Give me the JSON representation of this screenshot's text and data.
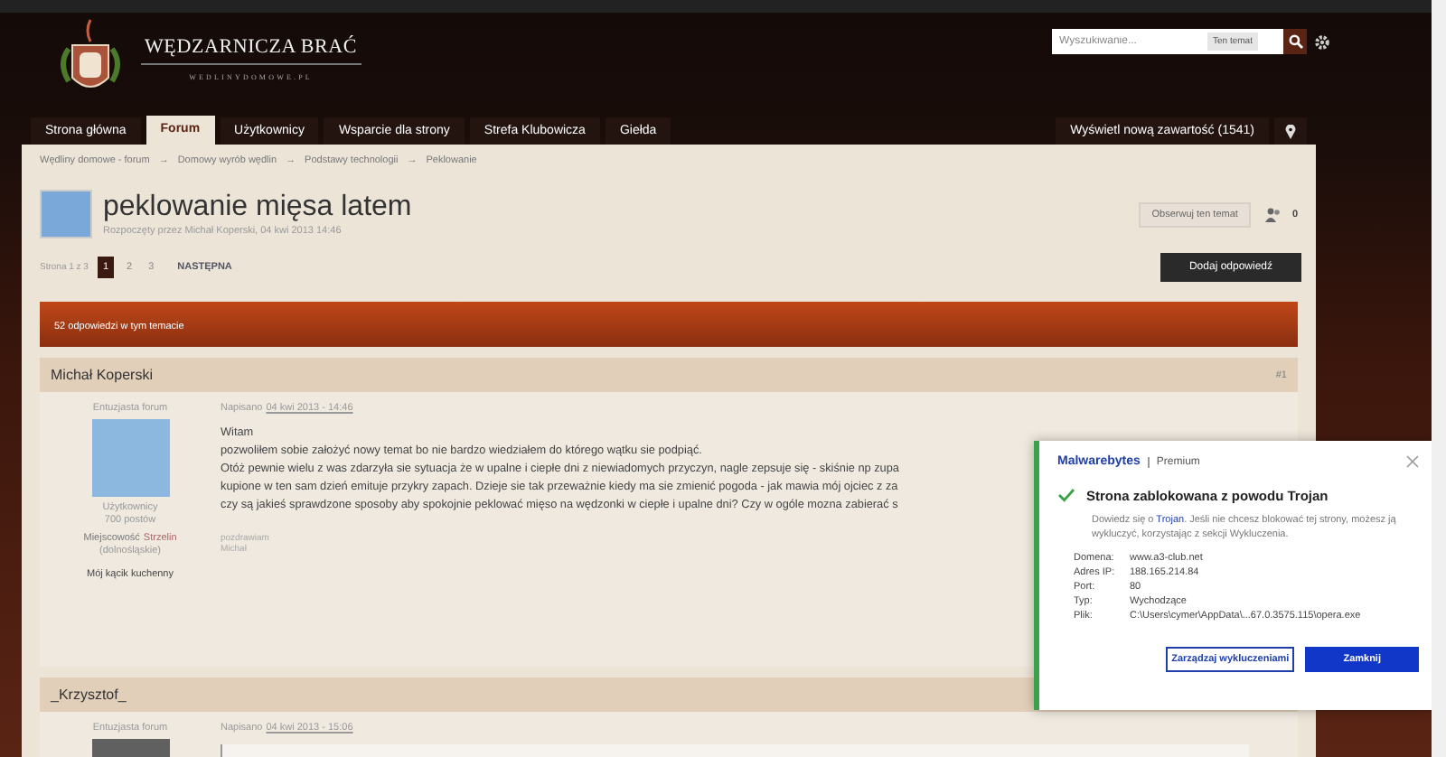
{
  "header": {
    "logo_title": "WĘDZARNICZA BRAĆ",
    "logo_subtitle": "WEDLINYDOMOWE.PL",
    "search": {
      "placeholder": "Wyszukiwanie...",
      "scope": "Ten temat"
    }
  },
  "nav": {
    "items": [
      {
        "label": "Strona główna",
        "selected": false
      },
      {
        "label": "Forum",
        "selected": true
      },
      {
        "label": "Użytkownicy",
        "selected": false
      },
      {
        "label": "Wsparcie dla strony",
        "selected": false
      },
      {
        "label": "Strefa Klubowicza",
        "selected": false
      },
      {
        "label": "Giełda",
        "selected": false
      }
    ],
    "new_content": "Wyświetl nową zawartość (1541)"
  },
  "breadcrumbs": {
    "separator": "→",
    "items": [
      "Wędliny domowe - forum",
      "Domowy wyrób wędlin",
      "Podstawy technologii",
      "Peklowanie"
    ]
  },
  "topic": {
    "title": "peklowanie mięsa latem",
    "started_by": "Rozpoczęty przez Michał Koperski, 04 kwi 2013 14:46",
    "follow_button": "Obserwuj ten temat",
    "follower_count": "0"
  },
  "pagination": {
    "label": "Strona 1 z 3",
    "pages": [
      {
        "label": "1",
        "selected": true
      },
      {
        "label": "2",
        "selected": false
      },
      {
        "label": "3",
        "selected": false
      }
    ],
    "next": "NASTĘPNA"
  },
  "reply_button": "Dodaj odpowiedź",
  "replies_bar": "52 odpowiedzi w tym temacie",
  "posts": [
    {
      "author": "Michał Koperski",
      "number": "#1",
      "rank": "Entuzjasta forum",
      "group": "Użytkownicy",
      "post_count": "700 postów",
      "location_label": "Miejscowość",
      "location_value": "Strzelin",
      "region": "(dolnośląskie)",
      "kitchen_link": "Mój kącik kuchenny",
      "date_prefix": "Napisano",
      "date": "04 kwi 2013 - 14:46",
      "body_lines": [
        "Witam",
        "pozwoliłem sobie założyć nowy temat bo nie bardzo wiedziałem do którego wątku sie podpiąć.",
        "Otóż pewnie wielu z was zdarzyła sie sytuacja że w upalne i ciepłe dni z niewiadomych przyczyn, nagle zepsuje się - skiśnie np zupa",
        "kupione w ten sam dzień emituje przykry zapach. Dzieje sie tak przeważnie kiedy ma sie zmienić pogoda - jak mawia mój ojciec z za",
        "czy są jakieś sprawdzone sposoby aby spokojnie peklować mięso na wędzonki w ciepłe i upalne dni? Czy w ogóle mozna zabierać s"
      ],
      "signature_lines": [
        "pozdrawiam",
        "Michał"
      ]
    },
    {
      "author": "_Krzysztof_",
      "rank": "Entuzjasta forum",
      "date_prefix": "Napisano",
      "date": "04 kwi 2013 - 15:06"
    }
  ],
  "popup": {
    "brand": "Malwarebytes",
    "tier": "Premium",
    "title": "Strona zablokowana z powodu Trojan",
    "desc_before": "Dowiedz się o ",
    "desc_link": "Trojan",
    "desc_after": ". Jeśli nie chcesz blokować tej strony, możesz ją wykluczyć, korzystając z sekcji Wykluczenia.",
    "details": [
      {
        "label": "Domena:",
        "value": "www.a3-club.net"
      },
      {
        "label": "Adres IP:",
        "value": "188.165.214.84"
      },
      {
        "label": "Port:",
        "value": "80"
      },
      {
        "label": "Typ:",
        "value": "Wychodzące"
      },
      {
        "label": "Plik:",
        "value": "C:\\Users\\cymer\\AppData\\...67.0.3575.115\\opera.exe"
      }
    ],
    "secondary_button": "Zarządzaj wykluczeniami",
    "primary_button": "Zamknij"
  }
}
